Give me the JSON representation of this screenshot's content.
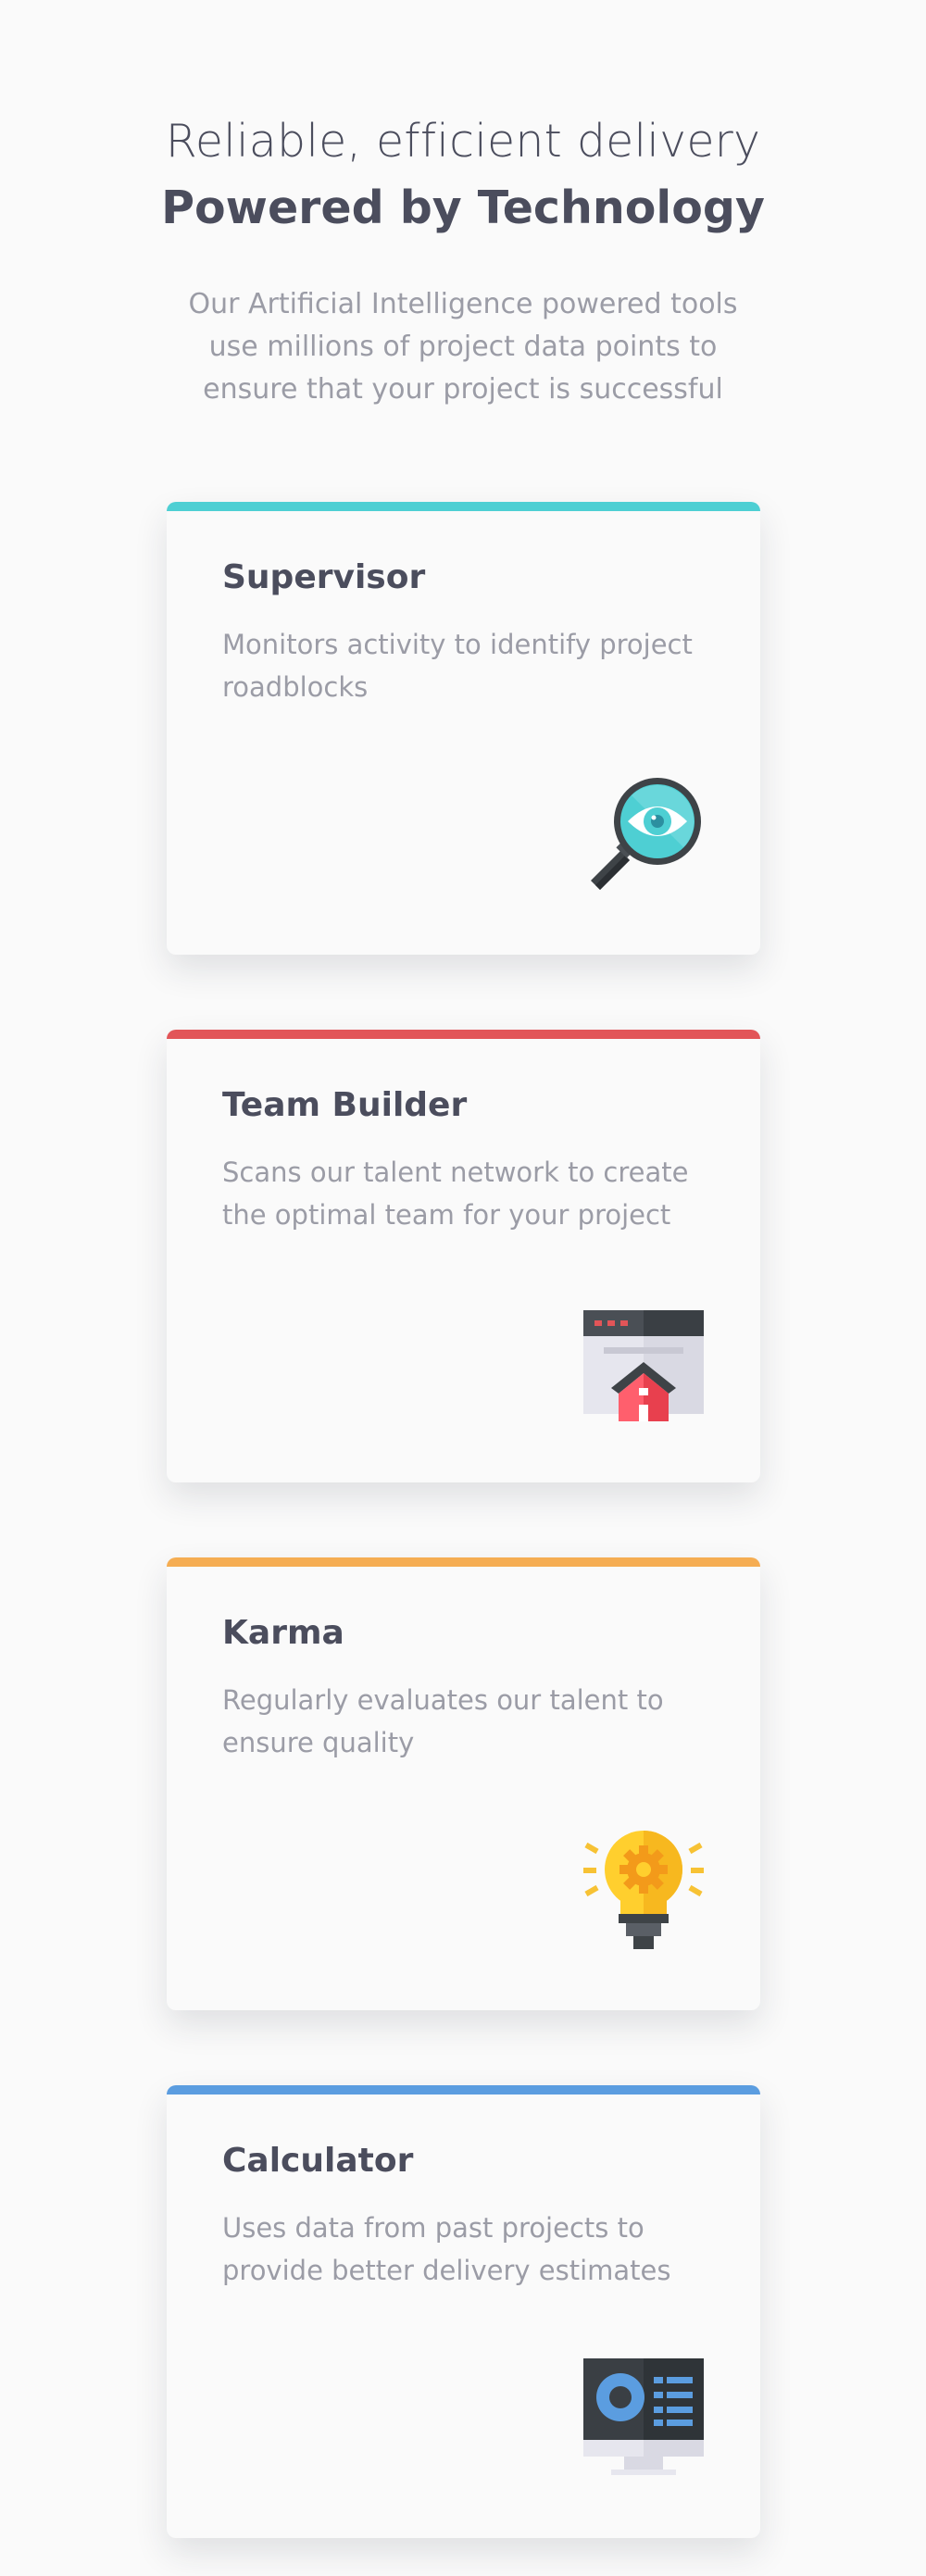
{
  "header": {
    "subtitle": "Reliable, efficient delivery",
    "title": "Powered by Technology",
    "description": "Our Artificial Intelligence powered tools use millions of project data points to ensure that your project is successful"
  },
  "cards": [
    {
      "title": "Supervisor",
      "description": "Monitors activity to identify project roadblocks",
      "accent": "#4ecfd3",
      "icon": "magnifier-eye-icon"
    },
    {
      "title": "Team Builder",
      "description": "Scans our talent network to create the optimal team for your project",
      "accent": "#e25558",
      "icon": "browser-house-icon"
    },
    {
      "title": "Karma",
      "description": "Regularly evaluates our talent to ensure quality",
      "accent": "#f5ad52",
      "icon": "lightbulb-gear-icon"
    },
    {
      "title": "Calculator",
      "description": "Uses data from past projects to provide better delivery estimates",
      "accent": "#5b9de0",
      "icon": "monitor-dashboard-icon"
    }
  ]
}
